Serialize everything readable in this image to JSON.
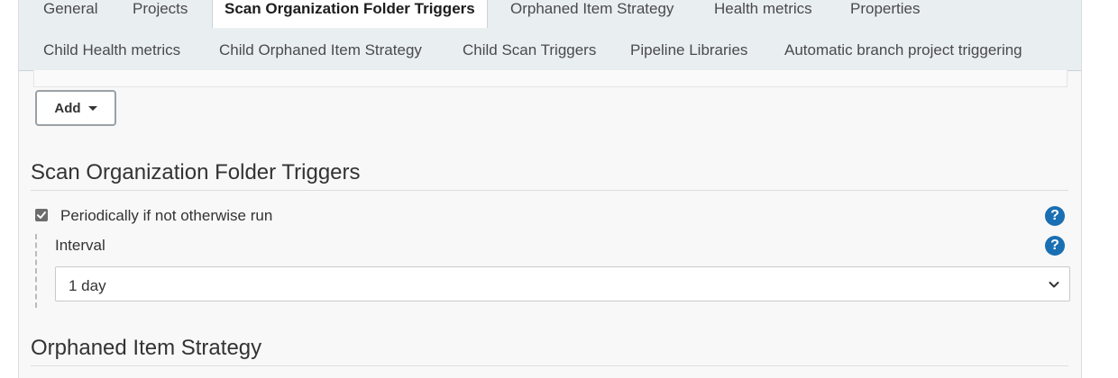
{
  "tabs": {
    "row1": [
      {
        "label": "General",
        "active": false
      },
      {
        "label": "Projects",
        "active": false
      },
      {
        "label": "Scan Organization Folder Triggers",
        "active": true
      },
      {
        "label": "Orphaned Item Strategy",
        "active": false
      },
      {
        "label": "Health metrics",
        "active": false
      },
      {
        "label": "Properties",
        "active": false
      }
    ],
    "row2": [
      {
        "label": "Child Health metrics"
      },
      {
        "label": "Child Orphaned Item Strategy"
      },
      {
        "label": "Child Scan Triggers"
      },
      {
        "label": "Pipeline Libraries"
      },
      {
        "label": "Automatic branch project triggering"
      }
    ]
  },
  "add_button": {
    "label": "Add",
    "icon": "caret-down-icon"
  },
  "scan_triggers": {
    "title": "Scan Organization Folder Triggers",
    "periodic": {
      "label": "Periodically if not otherwise run",
      "checked": true,
      "help_icon": "question-circle-icon"
    },
    "interval": {
      "label": "Interval",
      "value": "1 day",
      "help_icon": "question-circle-icon"
    }
  },
  "orphaned": {
    "title": "Orphaned Item Strategy"
  },
  "colors": {
    "help_blue": "#1a6fb3",
    "tab_bar_bg": "#e9eef1",
    "panel_bg": "#f8f8f8"
  }
}
